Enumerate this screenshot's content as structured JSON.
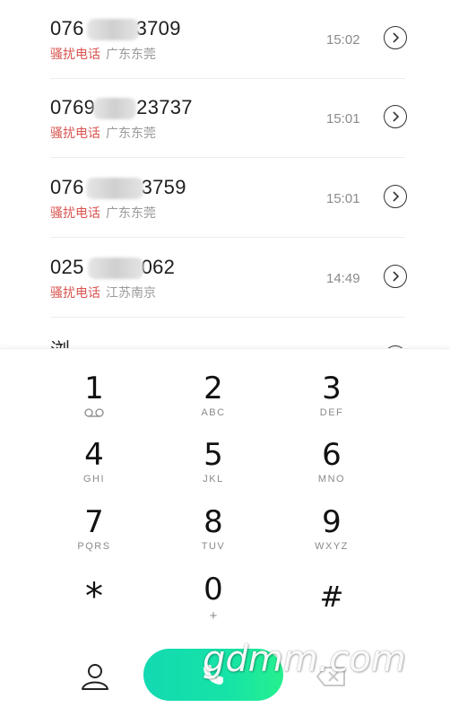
{
  "call_log": [
    {
      "number_start": "076",
      "number_end": "3709",
      "tag": "骚扰电话",
      "location": "广东东莞",
      "time": "15:02"
    },
    {
      "number_start": "0769",
      "number_end": "23737",
      "tag": "骚扰电话",
      "location": "广东东莞",
      "time": "15:01"
    },
    {
      "number_start": "076",
      "number_end": "3759",
      "tag": "骚扰电话",
      "location": "广东东莞",
      "time": "15:01"
    },
    {
      "number_start": "025",
      "number_end": "062",
      "tag": "骚扰电话",
      "location": "江苏南京",
      "time": "14:49"
    }
  ],
  "partial_row": {
    "label": "浏"
  },
  "keypad": [
    {
      "digit": "1",
      "letters": "",
      "icon": "voicemail-icon"
    },
    {
      "digit": "2",
      "letters": "ABC"
    },
    {
      "digit": "3",
      "letters": "DEF"
    },
    {
      "digit": "4",
      "letters": "GHI"
    },
    {
      "digit": "5",
      "letters": "JKL"
    },
    {
      "digit": "6",
      "letters": "MNO"
    },
    {
      "digit": "7",
      "letters": "PQRS"
    },
    {
      "digit": "8",
      "letters": "TUV"
    },
    {
      "digit": "9",
      "letters": "WXYZ"
    },
    {
      "digit": "*",
      "letters": ""
    },
    {
      "digit": "0",
      "letters": "+"
    },
    {
      "digit": "#",
      "letters": ""
    }
  ],
  "bottom_bar": {
    "contacts_icon": "person-icon",
    "call_icon": "phone-icon",
    "backspace_icon": "backspace-icon"
  },
  "watermark": "gdmm.com",
  "colors": {
    "spam_tag": "#d9534f",
    "call_button_start": "#13d9b1",
    "call_button_end": "#25f08f"
  }
}
